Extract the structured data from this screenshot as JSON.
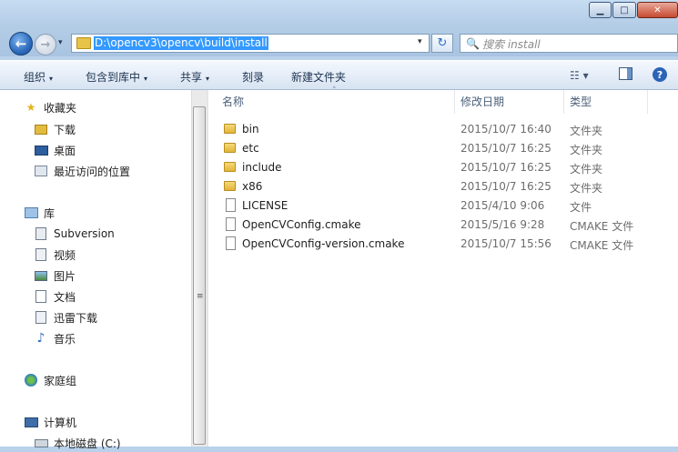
{
  "window": {
    "minimize_glyph": "▁",
    "maximize_glyph": "□",
    "close_glyph": "✕"
  },
  "nav": {
    "back_glyph": "←",
    "forward_glyph": "→",
    "dropdown_glyph": "▾"
  },
  "address": {
    "path": "D:\\opencv3\\opencv\\build\\install",
    "dropdown_glyph": "▾",
    "refresh_glyph": "↻"
  },
  "search": {
    "placeholder": "搜索 install",
    "icon_glyph": "🔍"
  },
  "toolbar": {
    "organize": "组织",
    "include_in_library": "包含到库中",
    "share": "共享",
    "burn": "刻录",
    "new_folder": "新建文件夹",
    "caret": "▾",
    "view_glyph": "☷ ▾",
    "help_glyph": "?"
  },
  "sidebar": {
    "favorites": {
      "label": "收藏夹",
      "items": [
        {
          "label": "下载",
          "icon": "download-folder-icon"
        },
        {
          "label": "桌面",
          "icon": "desktop-icon"
        },
        {
          "label": "最近访问的位置",
          "icon": "recent-places-icon"
        }
      ]
    },
    "libraries": {
      "label": "库",
      "items": [
        {
          "label": "Subversion",
          "icon": "subversion-icon"
        },
        {
          "label": "视频",
          "icon": "video-icon"
        },
        {
          "label": "图片",
          "icon": "pictures-icon"
        },
        {
          "label": "文档",
          "icon": "documents-icon"
        },
        {
          "label": "迅雷下载",
          "icon": "thunder-download-icon"
        },
        {
          "label": "音乐",
          "icon": "music-icon"
        }
      ]
    },
    "homegroup": {
      "label": "家庭组"
    },
    "computer": {
      "label": "计算机",
      "items": [
        {
          "label": "本地磁盘 (C:)",
          "icon": "local-disk-icon"
        }
      ]
    },
    "scroll_grip": "≡"
  },
  "columns": {
    "name": "名称",
    "modified": "修改日期",
    "type": "类型",
    "sort_glyph": "˄"
  },
  "files": [
    {
      "name": "bin",
      "modified": "2015/10/7 16:40",
      "type": "文件夹",
      "kind": "folder"
    },
    {
      "name": "etc",
      "modified": "2015/10/7 16:25",
      "type": "文件夹",
      "kind": "folder"
    },
    {
      "name": "include",
      "modified": "2015/10/7 16:25",
      "type": "文件夹",
      "kind": "folder"
    },
    {
      "name": "x86",
      "modified": "2015/10/7 16:25",
      "type": "文件夹",
      "kind": "folder"
    },
    {
      "name": "LICENSE",
      "modified": "2015/4/10 9:06",
      "type": "文件",
      "kind": "file"
    },
    {
      "name": "OpenCVConfig.cmake",
      "modified": "2015/5/16 9:28",
      "type": "CMAKE 文件",
      "kind": "file"
    },
    {
      "name": "OpenCVConfig-version.cmake",
      "modified": "2015/10/7 15:56",
      "type": "CMAKE 文件",
      "kind": "file"
    }
  ]
}
